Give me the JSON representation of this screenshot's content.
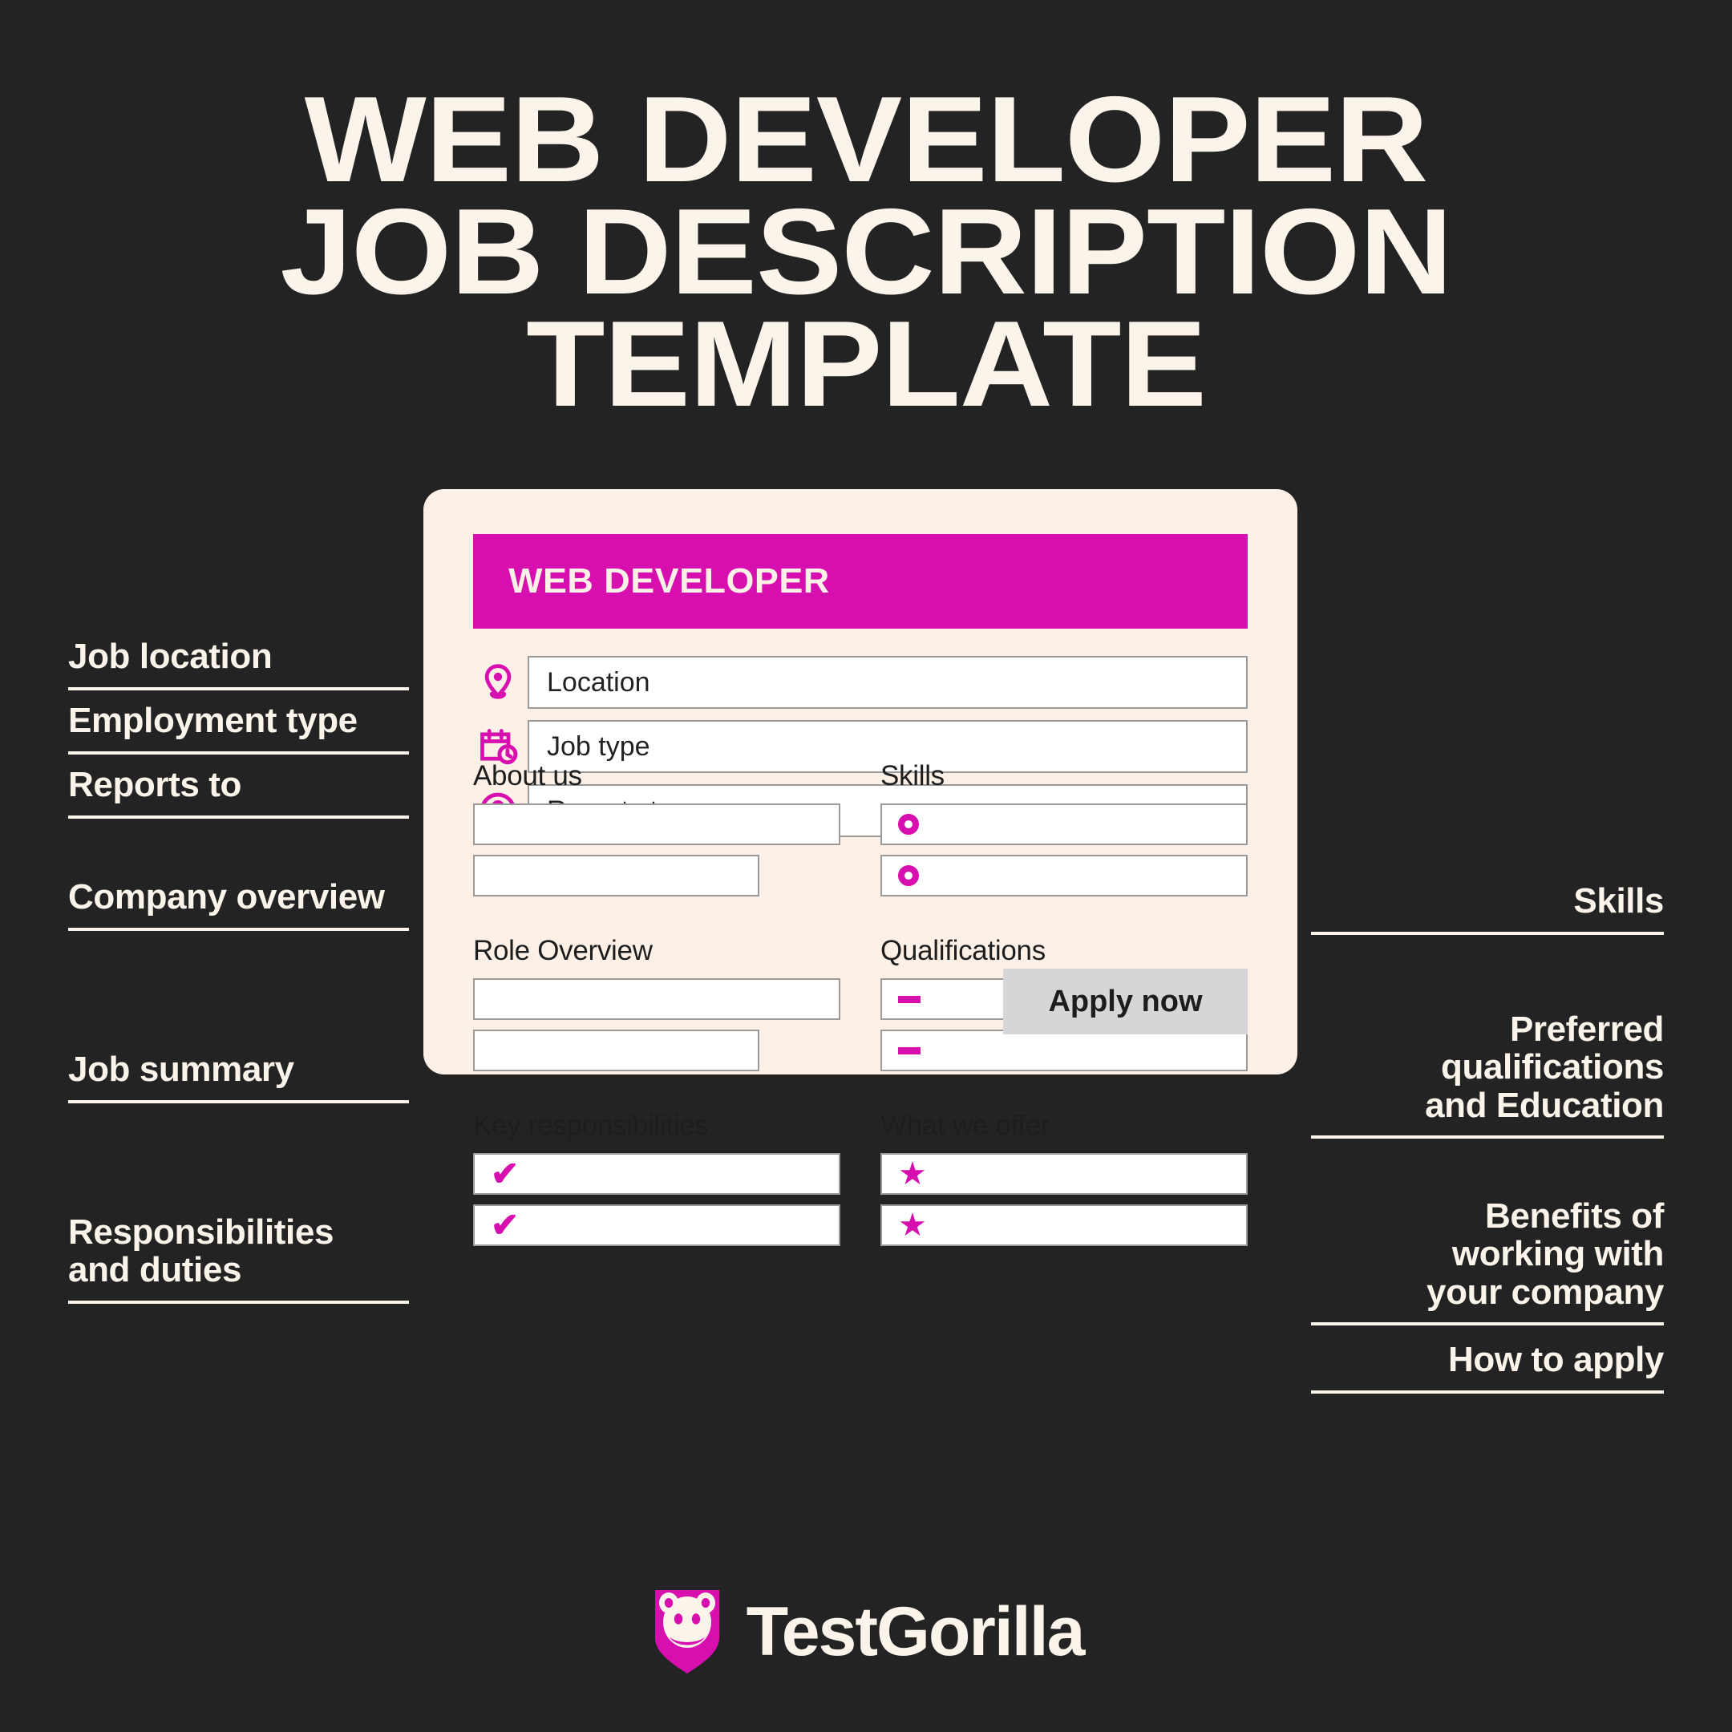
{
  "title": {
    "line1": "WEB DEVELOPER",
    "line2": "JOB DESCRIPTION",
    "line3": "TEMPLATE"
  },
  "colors": {
    "background": "#232323",
    "card": "#FDF1E7",
    "accent": "#D70FAE",
    "text_light": "#FBF4EA",
    "text_dark": "#1d1d1d",
    "button": "#D6D6D8"
  },
  "card": {
    "header_title": "WEB DEVELOPER",
    "meta_rows": [
      {
        "icon": "location-pin-icon",
        "value": "Location"
      },
      {
        "icon": "calendar-clock-icon",
        "value": "Job type"
      },
      {
        "icon": "person-circle-icon",
        "value": "Reports to"
      }
    ],
    "sections": {
      "about_us": {
        "label": "About us",
        "rows": [
          "",
          ""
        ]
      },
      "skills": {
        "label": "Skills",
        "marker": "ring",
        "rows": [
          "",
          ""
        ]
      },
      "role_overview": {
        "label": "Role Overview",
        "rows": [
          "",
          ""
        ]
      },
      "qualifications": {
        "label": "Qualifications",
        "marker": "dash",
        "rows": [
          "-",
          "-"
        ]
      },
      "key_responsibilities": {
        "label": "Key responsibilities",
        "marker": "check",
        "rows": [
          "✔",
          "✔"
        ]
      },
      "what_we_offer": {
        "label": "What we offer",
        "marker": "star",
        "rows": [
          "★",
          "★"
        ]
      }
    },
    "apply_button": "Apply now"
  },
  "left_labels": [
    {
      "text": "Job location"
    },
    {
      "text": "Employment type"
    },
    {
      "text": "Reports to"
    },
    {
      "text": "Company overview"
    },
    {
      "text": "Job summary"
    },
    {
      "text": "Responsibilities\nand duties"
    }
  ],
  "right_labels": [
    {
      "text": "Skills"
    },
    {
      "text": "Preferred\nqualifications\nand Education"
    },
    {
      "text": "Benefits of\nworking with\nyour company"
    },
    {
      "text": "How to apply"
    }
  ],
  "footer": {
    "logo_icon": "testgorilla-gorilla-badge-icon",
    "wordmark": "TestGorilla"
  }
}
